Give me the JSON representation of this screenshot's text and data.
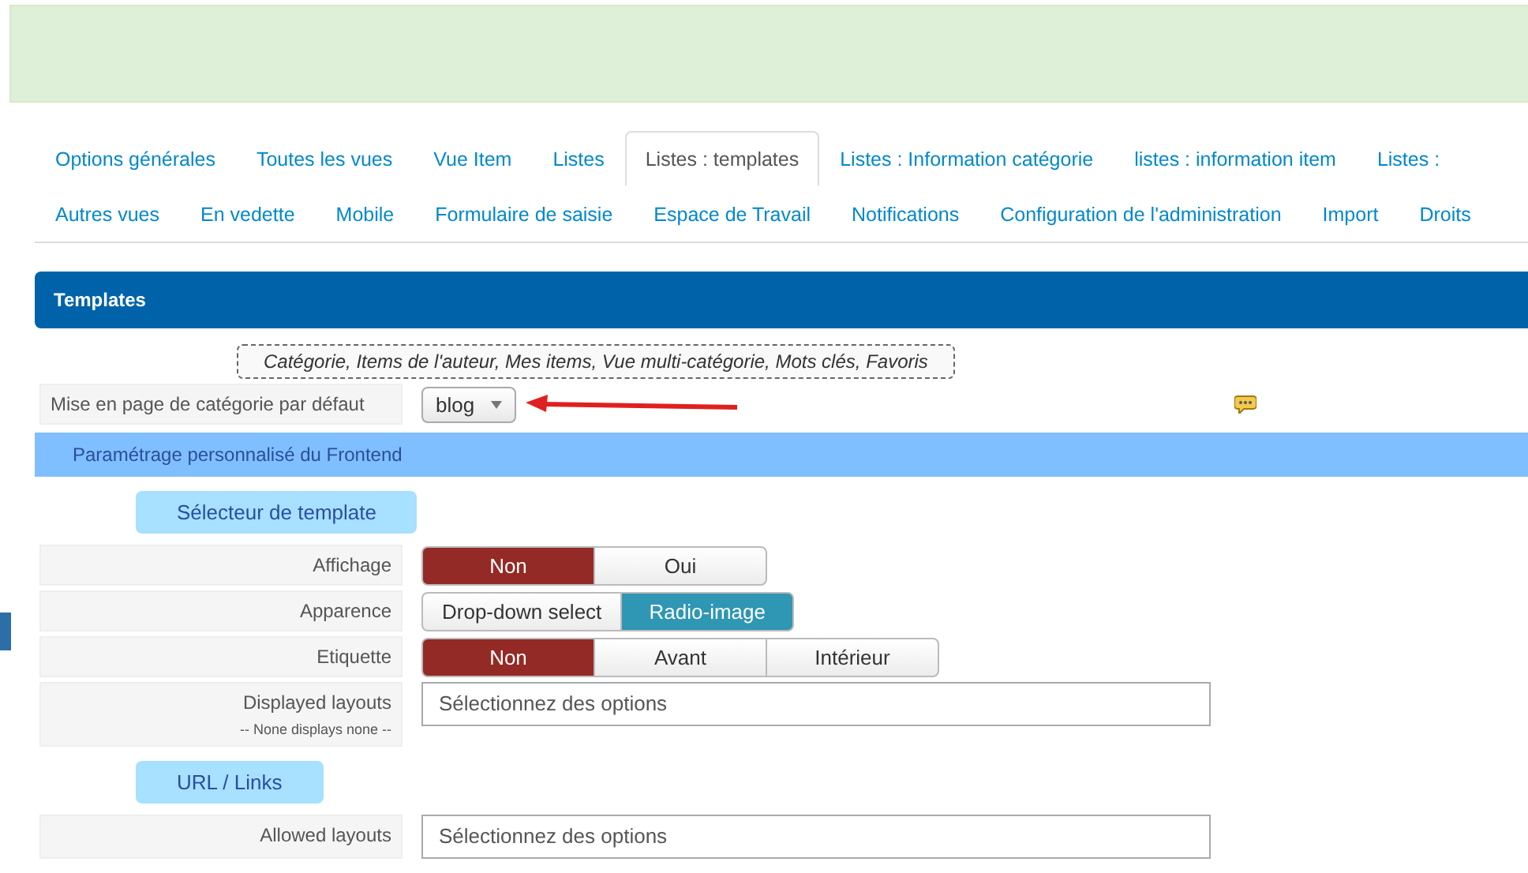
{
  "tabs": [
    [
      {
        "label": "Options générales",
        "selected": false
      },
      {
        "label": "Toutes les vues",
        "selected": false
      },
      {
        "label": "Vue Item",
        "selected": false
      },
      {
        "label": "Listes",
        "selected": false
      },
      {
        "label": "Listes : templates",
        "selected": true
      },
      {
        "label": "Listes : Information catégorie",
        "selected": false
      },
      {
        "label": "listes : information item",
        "selected": false
      },
      {
        "label": "Listes :",
        "selected": false
      }
    ],
    [
      {
        "label": "Autres vues",
        "selected": false
      },
      {
        "label": "En vedette",
        "selected": false
      },
      {
        "label": "Mobile",
        "selected": false
      },
      {
        "label": "Formulaire de saisie",
        "selected": false
      },
      {
        "label": "Espace de Travail",
        "selected": false
      },
      {
        "label": "Notifications",
        "selected": false
      },
      {
        "label": "Configuration de l'administration",
        "selected": false
      },
      {
        "label": "Import",
        "selected": false
      },
      {
        "label": "Droits",
        "selected": false
      }
    ]
  ],
  "panel_title": "Templates",
  "hint": "Catégorie, Items de l'auteur, Mes items, Vue multi-catégorie, Mots clés, Favoris",
  "default_layout": {
    "label": "Mise en page de catégorie par défaut",
    "value": "blog"
  },
  "subpanel_title": "Paramétrage personnalisé du Frontend",
  "sections": [
    {
      "title": "Sélecteur de template",
      "rows": [
        {
          "kind": "toggle",
          "label": "Affichage",
          "color": "#942a25",
          "options": [
            {
              "label": "Non",
              "selected": true
            },
            {
              "label": "Oui",
              "selected": false
            }
          ]
        },
        {
          "kind": "toggle",
          "label": "Apparence",
          "color": "#2f96b4",
          "options": [
            {
              "label": "Drop-down select",
              "selected": false
            },
            {
              "label": "Radio-image",
              "selected": true
            }
          ]
        },
        {
          "kind": "toggle",
          "label": "Etiquette",
          "color": "#942a25",
          "options": [
            {
              "label": "Non",
              "selected": true
            },
            {
              "label": "Avant",
              "selected": false
            },
            {
              "label": "Intérieur",
              "selected": false
            }
          ]
        },
        {
          "kind": "multiselect",
          "label": "Displayed layouts",
          "note": "-- None displays none --",
          "placeholder": "Sélectionnez des options"
        }
      ]
    },
    {
      "title": "URL / Links",
      "rows": [
        {
          "kind": "multiselect",
          "label": "Allowed layouts",
          "placeholder": "Sélectionnez des options"
        }
      ]
    }
  ]
}
